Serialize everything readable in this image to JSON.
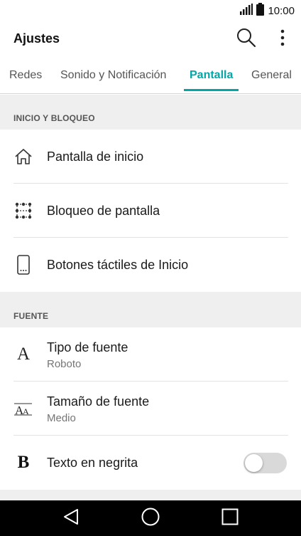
{
  "status_bar": {
    "time": "10:00",
    "signal_icon": "signal-icon",
    "battery_icon": "battery-icon"
  },
  "app_bar": {
    "title": "Ajustes",
    "search_icon": "search-icon",
    "more_icon": "more-vert-icon"
  },
  "tabs": [
    {
      "label": "Redes",
      "active": false
    },
    {
      "label": "Sonido y Notificación",
      "active": false
    },
    {
      "label": "Pantalla",
      "active": true
    },
    {
      "label": "General",
      "active": false
    }
  ],
  "sections": [
    {
      "header": "INICIO Y BLOQUEO",
      "items": [
        {
          "title": "Pantalla de inicio",
          "icon": "home-icon"
        },
        {
          "title": "Bloqueo de pantalla",
          "icon": "lock-pattern-icon"
        },
        {
          "title": "Botones táctiles de Inicio",
          "icon": "phone-touch-buttons-icon"
        }
      ]
    },
    {
      "header": "FUENTE",
      "items": [
        {
          "title": "Tipo de fuente",
          "subtitle": "Roboto",
          "icon": "font-type-icon"
        },
        {
          "title": "Tamaño de fuente",
          "subtitle": "Medio",
          "icon": "font-size-icon"
        },
        {
          "title": "Texto en negrita",
          "icon": "bold-icon",
          "toggle_on": false
        }
      ]
    }
  ],
  "nav_bar": {
    "back_icon": "back-icon",
    "home_icon": "home-circle-icon",
    "recents_icon": "recents-icon"
  },
  "colors": {
    "accent": "#00a7a7",
    "section_bg": "#efefef",
    "nav_bg": "#000000"
  }
}
